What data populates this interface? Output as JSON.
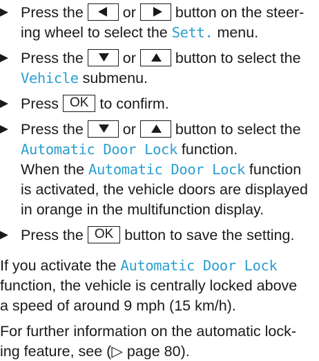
{
  "colors": {
    "highlight": "#2a9fd0",
    "text": "#1a1a1a"
  },
  "icons": {
    "bullet": "triangle-right-bullet-icon",
    "left": "left-arrow-button-icon",
    "right": "right-arrow-button-icon",
    "down": "down-arrow-button-icon",
    "up": "up-arrow-button-icon"
  },
  "steps": [
    {
      "l1_a": "Press the",
      "l1_or": "or",
      "l1_b": "button on the steer-",
      "l2_a": "ing wheel to select the",
      "l2_hl": "Sett.",
      "l2_b": "menu."
    },
    {
      "l1_a": "Press the",
      "l1_or": "or",
      "l1_b": "button to select the",
      "l2_hl": "Vehicle",
      "l2_b": "submenu."
    },
    {
      "l1_a": "Press",
      "key": "OK",
      "l1_b": "to confirm."
    },
    {
      "l1_a": "Press the",
      "l1_or": "or",
      "l1_b": "button to select the",
      "l2_hl": "Automatic Door Lock",
      "l2_b": "function.",
      "l3_a": "When the",
      "l3_hl": "Automatic Door Lock",
      "l3_b": "function",
      "l4": "is activated, the vehicle doors are displayed",
      "l5": "in orange in the multifunction display."
    },
    {
      "l1_a": "Press the",
      "key": "OK",
      "l1_b": "button to save the setting."
    }
  ],
  "para1": {
    "l1_a": "If you activate the",
    "l1_hl": "Automatic Door Lock",
    "l2": "function, the vehicle is centrally locked above",
    "l3": "a speed of around 9 mph (15 km/h)."
  },
  "para2": {
    "l1": "For further information on the automatic lock-",
    "l2": "ing feature, see (▷ page 80)."
  }
}
